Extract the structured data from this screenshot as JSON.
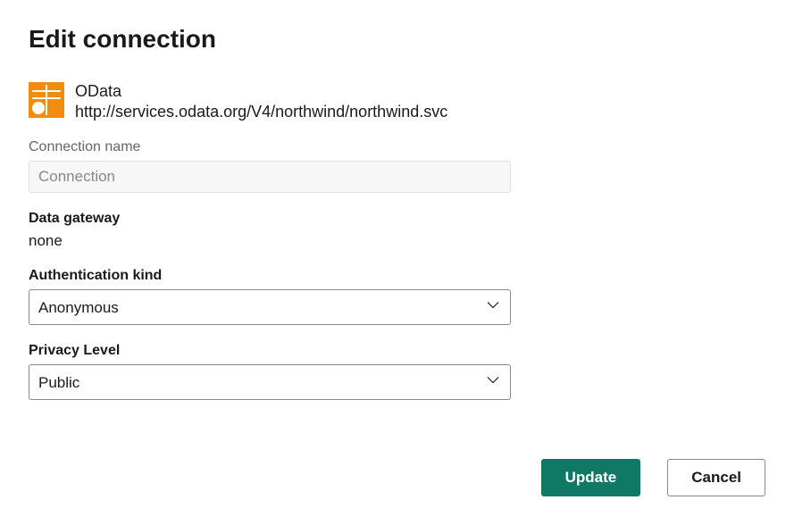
{
  "title": "Edit connection",
  "connection": {
    "type": "OData",
    "url": "http://services.odata.org/V4/northwind/northwind.svc",
    "iconColors": {
      "primary": "#F28C0F",
      "accent": "#ffffff"
    }
  },
  "fields": {
    "connectionName": {
      "label": "Connection name",
      "placeholder": "Connection",
      "value": ""
    },
    "dataGateway": {
      "label": "Data gateway",
      "value": "none"
    },
    "authenticationKind": {
      "label": "Authentication kind",
      "value": "Anonymous"
    },
    "privacyLevel": {
      "label": "Privacy Level",
      "value": "Public"
    }
  },
  "buttons": {
    "update": "Update",
    "cancel": "Cancel"
  }
}
